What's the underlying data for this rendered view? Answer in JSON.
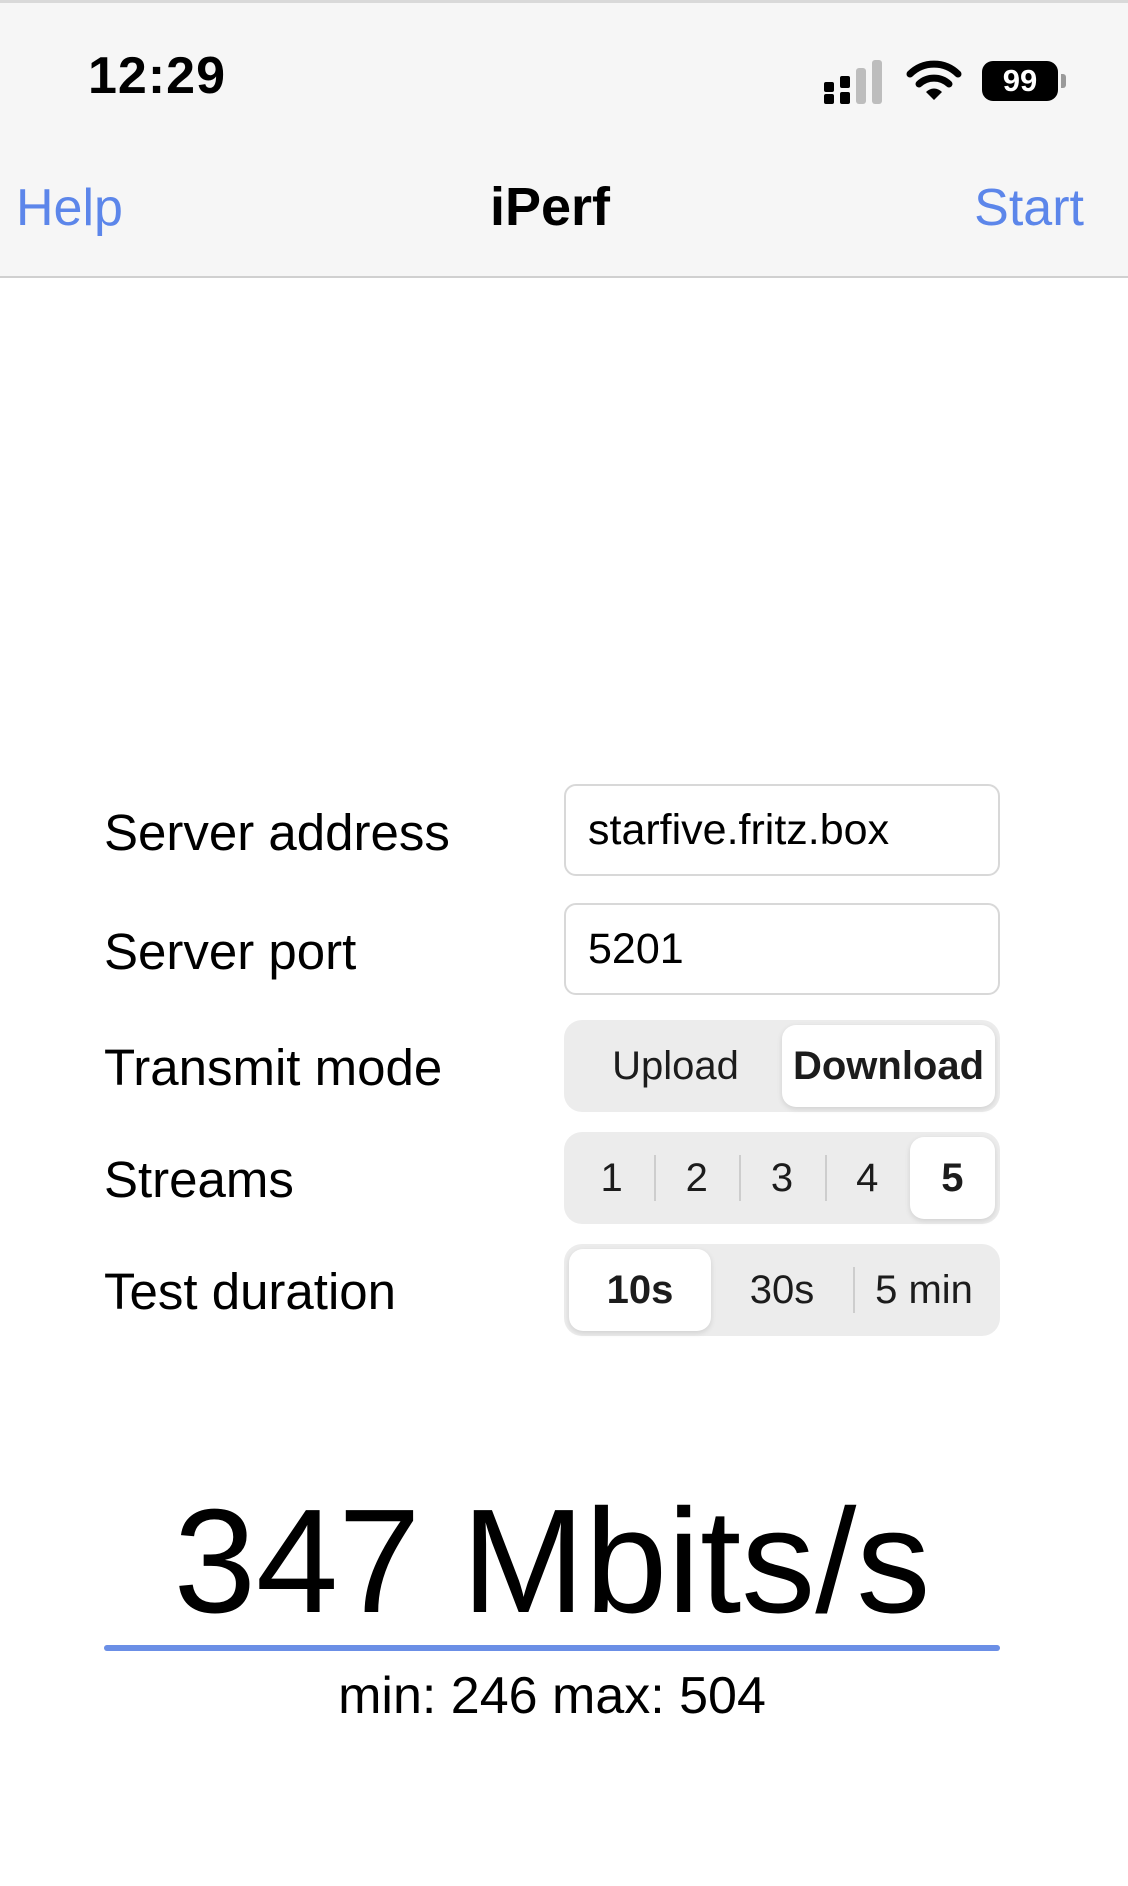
{
  "status_bar": {
    "time": "12:29",
    "battery": "99",
    "icons": [
      "cellular-signal-icon",
      "wifi-icon",
      "battery-icon"
    ]
  },
  "nav": {
    "left_button": "Help",
    "title": "iPerf",
    "right_button": "Start",
    "accent_color": "#5c86ea"
  },
  "form": {
    "server_address": {
      "label": "Server address",
      "value": "starfive.fritz.box"
    },
    "server_port": {
      "label": "Server port",
      "value": "5201"
    },
    "transmit_mode": {
      "label": "Transmit mode",
      "options": [
        "Upload",
        "Download"
      ],
      "selected": "Download"
    },
    "streams": {
      "label": "Streams",
      "options": [
        "1",
        "2",
        "3",
        "4",
        "5"
      ],
      "selected": "5"
    },
    "test_duration": {
      "label": "Test duration",
      "options": [
        "10s",
        "30s",
        "5 min"
      ],
      "selected": "10s"
    }
  },
  "result": {
    "value": "347 Mbits/s",
    "min_max": "min: 246 max: 504",
    "progress_fraction": 1.0
  }
}
